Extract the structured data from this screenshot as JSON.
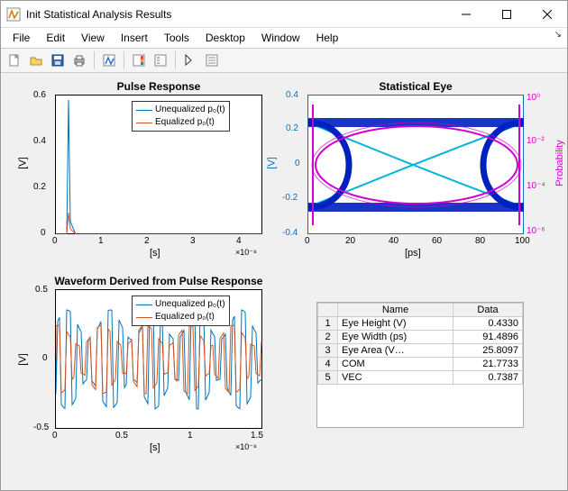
{
  "window": {
    "title": "Init Statistical Analysis Results"
  },
  "menu": {
    "file": "File",
    "edit": "Edit",
    "view": "View",
    "insert": "Insert",
    "tools": "Tools",
    "desktop": "Desktop",
    "window": "Window",
    "help": "Help"
  },
  "plot1": {
    "title": "Pulse Response",
    "xlabel": "[s]",
    "ylabel": "[V]",
    "xexp": "×10⁻⁸",
    "legend": {
      "a": "Unequalized p₀(t)",
      "b": "Equalized p₀(t)"
    },
    "xticks": [
      "0",
      "1",
      "2",
      "3",
      "4"
    ],
    "yticks": [
      "0",
      "0.2",
      "0.4",
      "0.6"
    ]
  },
  "plot2": {
    "title": "Statistical Eye",
    "xlabel": "[ps]",
    "ylabel": "[V]",
    "y2label": "Probability",
    "xticks": [
      "0",
      "20",
      "40",
      "60",
      "80",
      "100"
    ],
    "yticks": [
      "-0.4",
      "-0.2",
      "0",
      "0.2",
      "0.4"
    ],
    "y2ticks": [
      "10⁻⁶",
      "10⁻⁴",
      "10⁻²",
      "10⁰"
    ]
  },
  "plot3": {
    "title": "Waveform Derived from Pulse Response",
    "xlabel": "[s]",
    "ylabel": "[V]",
    "xexp": "×10⁻⁸",
    "legend": {
      "a": "Unequalized p₀(t)",
      "b": "Equalized p₀(t)"
    },
    "xticks": [
      "0",
      "0.5",
      "1",
      "1.5"
    ],
    "yticks": [
      "-0.5",
      "0",
      "0.5"
    ]
  },
  "table": {
    "headers": {
      "name": "Name",
      "data": "Data"
    },
    "rows": [
      {
        "idx": "1",
        "name": "Eye Height (V)",
        "data": "0.4330"
      },
      {
        "idx": "2",
        "name": "Eye Width (ps)",
        "data": "91.4896"
      },
      {
        "idx": "3",
        "name": "Eye Area (V…",
        "data": "25.8097"
      },
      {
        "idx": "4",
        "name": "COM",
        "data": "21.7733"
      },
      {
        "idx": "5",
        "name": "VEC",
        "data": "0.7387"
      }
    ]
  },
  "chart_data": [
    {
      "type": "line",
      "title": "Pulse Response",
      "xlabel": "[s]",
      "ylabel": "[V]",
      "xlim": [
        0,
        4.5e-08
      ],
      "ylim": [
        0,
        0.6
      ],
      "series": [
        {
          "name": "Unequalized p0(t)",
          "description": "single narrow pulse near t≈0.2e-8 s peaking at ≈0.6 V then ~0",
          "color": "#0072bd"
        },
        {
          "name": "Equalized p0(t)",
          "description": "single narrow pulse near t≈0.2e-8 s with smaller peak (<0.1 V) then ~0",
          "color": "#d95319"
        }
      ]
    },
    {
      "type": "heatmap/eye",
      "title": "Statistical Eye",
      "xlabel": "[ps]",
      "ylabel_left": "[V]",
      "ylabel_right": "Probability",
      "xlim": [
        0,
        100
      ],
      "ylim": [
        -0.4,
        0.4
      ],
      "y2scale": "log",
      "y2lim": [
        1e-06,
        1.0
      ],
      "contours_color": "#d000d0",
      "eye_color": "#0020c0",
      "crossing_ps": [
        0,
        100
      ],
      "eye_height_v": 0.433,
      "eye_width_ps": 91.4896
    },
    {
      "type": "line",
      "title": "Waveform Derived from Pulse Response",
      "xlabel": "[s]",
      "ylabel": "[V]",
      "xlim": [
        0,
        1.5e-08
      ],
      "ylim": [
        -0.5,
        0.5
      ],
      "series": [
        {
          "name": "Unequalized p0(t)",
          "description": "dense PRBS-like waveform oscillating roughly between -0.4 and 0.5 V",
          "color": "#0072bd"
        },
        {
          "name": "Equalized p0(t)",
          "description": "waveform oscillating roughly between -0.3 and 0.3 V, overlaid",
          "color": "#d95319"
        }
      ]
    }
  ]
}
